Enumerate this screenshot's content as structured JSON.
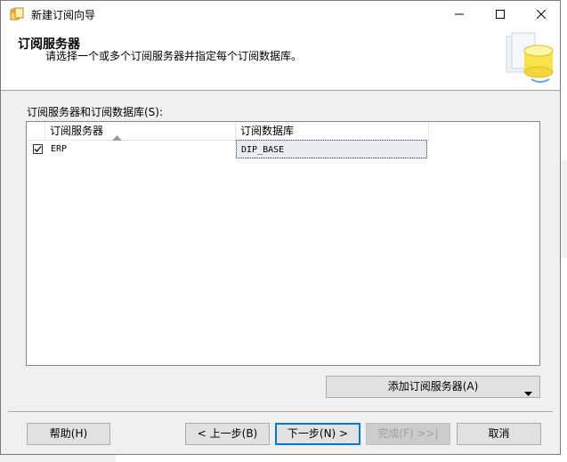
{
  "window": {
    "title": "新建订阅向导",
    "controls": {
      "minimize": "minimize",
      "maximize": "maximize",
      "close": "close"
    }
  },
  "header": {
    "title": "订阅服务器",
    "subtitle": "请选择一个或多个订阅服务器并指定每个订阅数据库。"
  },
  "grid": {
    "label": "订阅服务器和订阅数据库(S):",
    "columns": [
      "订阅服务器",
      "订阅数据库"
    ],
    "sorted_column": "订阅服务器",
    "rows": [
      {
        "checked": true,
        "server": "ERP",
        "database": "DIP_BASE"
      }
    ]
  },
  "add_subscriber_button": {
    "label": "添加订阅服务器(A)"
  },
  "footer": {
    "help": "帮助(H)",
    "back": "< 上一步(B)",
    "next": "下一步(N) >",
    "finish": "完成(F) >>|",
    "cancel": "取消"
  },
  "colors": {
    "accent": "#0078d7",
    "selection": "#e8ecf3"
  }
}
